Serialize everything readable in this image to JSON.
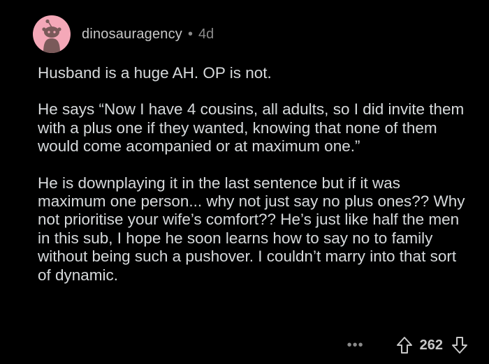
{
  "comment": {
    "author": "dinosauragency",
    "separator": "•",
    "age": "4d",
    "paragraphs": [
      "Husband is a huge AH. OP is not.",
      "He says “Now I have 4 cousins, all adults, so I did invite them with a plus one if they wanted, knowing that none of them would come acompanied or at maximum one.”",
      "He is downplaying it in the last sentence but if it was maximum one person... why not just say no plus ones?? Why not prioritise your wife’s comfort?? He’s just like half the men in this sub, I hope he soon learns how to say no to family without being such a pushover. I couldn’t marry into that sort of dynamic."
    ],
    "more_label": "•••",
    "score": "262"
  },
  "icons": {
    "avatar": "reddit-snoo-avatar",
    "upvote": "arrow-up-outline-icon",
    "downvote": "arrow-down-outline-icon",
    "more": "ellipsis-icon"
  },
  "colors": {
    "background": "#000000",
    "avatar_background": "#f4a8b8",
    "text": "#d7dadc",
    "muted": "#8a8a8a"
  }
}
